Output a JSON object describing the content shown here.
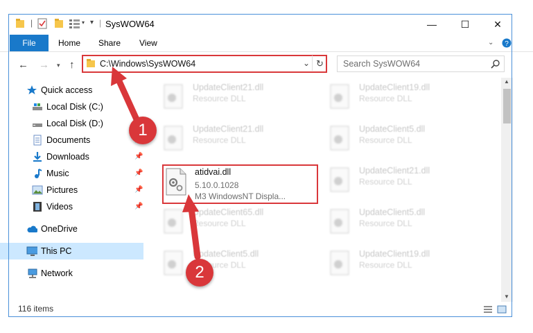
{
  "window": {
    "title": "SysWOW64",
    "minimize_glyph": "—",
    "maximize_glyph": "☐",
    "close_glyph": "✕"
  },
  "ribbon": {
    "tabs": [
      "File",
      "Home",
      "Share",
      "View"
    ],
    "accent": "#1979ca"
  },
  "address": {
    "path": "C:\\Windows\\SysWOW64",
    "search_placeholder": "Search SysWOW64"
  },
  "nav": {
    "items": [
      {
        "label": "Quick access",
        "icon": "star-icon"
      },
      {
        "label": "Local Disk (C:)",
        "icon": "drive-icon"
      },
      {
        "label": "Local Disk (D:)",
        "icon": "drive-icon"
      },
      {
        "label": "Documents",
        "icon": "documents-icon"
      },
      {
        "label": "Downloads",
        "icon": "download-icon"
      },
      {
        "label": "Music",
        "icon": "music-icon"
      },
      {
        "label": "Pictures",
        "icon": "pictures-icon"
      },
      {
        "label": "Videos",
        "icon": "videos-icon"
      },
      {
        "label": "OneDrive",
        "icon": "cloud-icon"
      },
      {
        "label": "This PC",
        "icon": "computer-icon"
      },
      {
        "label": "Network",
        "icon": "network-icon"
      }
    ]
  },
  "files": {
    "left_column": [
      {
        "name": "UpdateClient21.dll",
        "desc": "Resource DLL"
      },
      {
        "name": "UpdateClient21.dll",
        "desc": "Resource DLL"
      },
      {
        "name": "UpdateClient65.dll",
        "desc": "Resource DLL"
      },
      {
        "name": "UpdateClient5.dll",
        "desc": "Resource DLL"
      }
    ],
    "right_column": [
      {
        "name": "UpdateClient19.dll",
        "desc": "Resource DLL"
      },
      {
        "name": "UpdateClient5.dll",
        "desc": "Resource DLL"
      },
      {
        "name": "UpdateClient21.dll",
        "desc": "Resource DLL"
      },
      {
        "name": "UpdateClient5.dll",
        "desc": "Resource DLL"
      },
      {
        "name": "UpdateClient19.dll",
        "desc": "Resource DLL"
      }
    ],
    "selected": {
      "name": "atidvai.dll",
      "version": "5.10.0.1028",
      "description": "M3 WindowsNT Displa..."
    }
  },
  "status": {
    "item_count": "116 items"
  },
  "callouts": {
    "step1": "1",
    "step2": "2",
    "color": "#d9373a"
  }
}
